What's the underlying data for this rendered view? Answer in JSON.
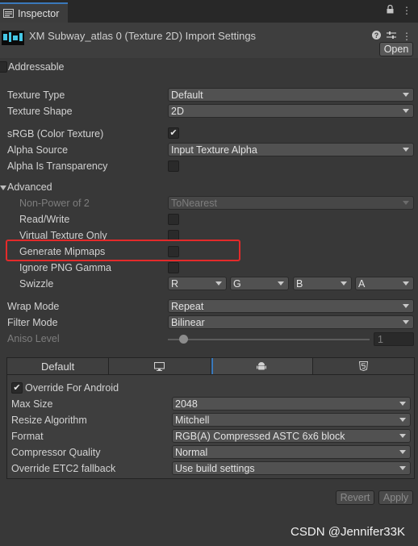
{
  "window": {
    "tab_title": "Inspector"
  },
  "header": {
    "title": "XM Subway_atlas 0 (Texture 2D) Import Settings",
    "open_button": "Open"
  },
  "addressable": {
    "label": "Addressable",
    "checked": false
  },
  "texture": {
    "type_label": "Texture Type",
    "type_value": "Default",
    "shape_label": "Texture Shape",
    "shape_value": "2D",
    "srgb_label": "sRGB (Color Texture)",
    "srgb_checked": true,
    "alpha_source_label": "Alpha Source",
    "alpha_source_value": "Input Texture Alpha",
    "alpha_transparency_label": "Alpha Is Transparency",
    "alpha_transparency_checked": false
  },
  "advanced": {
    "label": "Advanced",
    "npot_label": "Non-Power of 2",
    "npot_value": "ToNearest",
    "readwrite_label": "Read/Write",
    "vt_label": "Virtual Texture Only",
    "mipmaps_label": "Generate Mipmaps",
    "png_gamma_label": "Ignore PNG Gamma",
    "swizzle_label": "Swizzle",
    "swizzle": [
      "R",
      "G",
      "B",
      "A"
    ]
  },
  "sampling": {
    "wrap_label": "Wrap Mode",
    "wrap_value": "Repeat",
    "filter_label": "Filter Mode",
    "filter_value": "Bilinear",
    "aniso_label": "Aniso Level",
    "aniso_value": "1"
  },
  "platform_tabs": [
    {
      "label": "Default",
      "icon": ""
    },
    {
      "label": "",
      "icon": "monitor-icon"
    },
    {
      "label": "",
      "icon": "android-icon"
    },
    {
      "label": "",
      "icon": "html5-icon"
    }
  ],
  "platform": {
    "override_label": "Override For Android",
    "override_checked": true,
    "max_size_label": "Max Size",
    "max_size_value": "2048",
    "resize_label": "Resize Algorithm",
    "resize_value": "Mitchell",
    "format_label": "Format",
    "format_value": "RGB(A) Compressed ASTC 6x6 block",
    "quality_label": "Compressor Quality",
    "quality_value": "Normal",
    "etc2_label": "Override ETC2 fallback",
    "etc2_value": "Use build settings"
  },
  "footer": {
    "revert": "Revert",
    "apply": "Apply"
  },
  "watermark": "CSDN @Jennifer33K",
  "colors": {
    "highlight": "#e42a2a",
    "accent": "#3a79bb"
  }
}
